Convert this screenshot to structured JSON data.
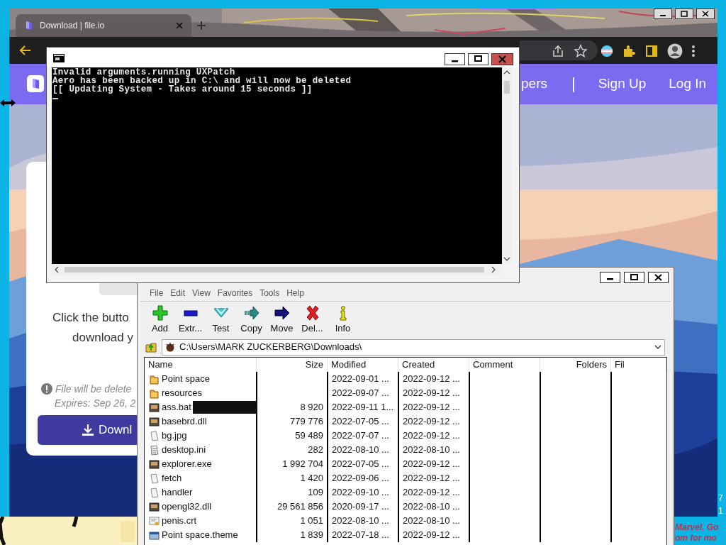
{
  "browser": {
    "tab": {
      "title": "Download | file.io",
      "selected": true
    },
    "nav": {
      "links": [
        "pers",
        "Sign Up",
        "Log In"
      ],
      "separator": "|"
    },
    "card": {
      "lines": [
        "Click the butto",
        "download y"
      ],
      "notice": "File will be delete",
      "expires": "Expires: Sep 26, 2",
      "button": "Downl"
    }
  },
  "console": {
    "lines": [
      "Invalid arguments.running UXPatch",
      "Aero has been backed up in C:\\ and will now be deleted",
      "[[ Updating System - Takes around 15 seconds ]]"
    ]
  },
  "archiver": {
    "menu": [
      "File",
      "Edit",
      "View",
      "Favorites",
      "Tools",
      "Help"
    ],
    "toolbar": [
      {
        "label": "Add",
        "kind": "add"
      },
      {
        "label": "Extr...",
        "kind": "extract"
      },
      {
        "label": "Test",
        "kind": "test"
      },
      {
        "label": "Copy",
        "kind": "copy"
      },
      {
        "label": "Move",
        "kind": "move"
      },
      {
        "label": "Del...",
        "kind": "delete"
      },
      {
        "label": "Info",
        "kind": "info"
      }
    ],
    "path": "C:\\Users\\MARK ZUCKERBERG\\Downloads\\",
    "columns": [
      "Name",
      "Size",
      "Modified",
      "Created",
      "Comment",
      "Folders",
      "Fil"
    ],
    "rows": [
      {
        "name": "Point space",
        "size": "",
        "modified": "2022-09-01 ...",
        "created": "2022-09-12 ...",
        "kind": "folder",
        "redacted": false
      },
      {
        "name": "resources",
        "size": "",
        "modified": "2022-09-07 ...",
        "created": "2022-09-12 ...",
        "kind": "folder",
        "redacted": false
      },
      {
        "name": "ass.bat",
        "size": "8 920",
        "modified": "2022-09-11 1...",
        "created": "2022-09-12 ...",
        "kind": "program",
        "redacted": true
      },
      {
        "name": "basebrd.dll",
        "size": "779 776",
        "modified": "2022-07-05 ...",
        "created": "2022-09-12 ...",
        "kind": "program",
        "redacted": false
      },
      {
        "name": "bg.jpg",
        "size": "59 489",
        "modified": "2022-07-07 ...",
        "created": "2022-09-12 ...",
        "kind": "document",
        "redacted": false
      },
      {
        "name": "desktop.ini",
        "size": "282",
        "modified": "2022-08-10 ...",
        "created": "2022-08-10 ...",
        "kind": "settings",
        "redacted": false
      },
      {
        "name": "explorer.exe",
        "size": "1 992 704",
        "modified": "2022-07-05 ...",
        "created": "2022-09-12 ...",
        "kind": "program",
        "redacted": false
      },
      {
        "name": "fetch",
        "size": "1 420",
        "modified": "2022-09-06 ...",
        "created": "2022-09-12 ...",
        "kind": "document",
        "redacted": false
      },
      {
        "name": "handler",
        "size": "109",
        "modified": "2022-09-10 ...",
        "created": "2022-09-12 ...",
        "kind": "document",
        "redacted": false
      },
      {
        "name": "opengl32.dll",
        "size": "29 561 856",
        "modified": "2020-09-17 ...",
        "created": "2022-08-10 ...",
        "kind": "program",
        "redacted": false
      },
      {
        "name": "penis.crt",
        "size": "1 051",
        "modified": "2022-08-10 ...",
        "created": "2022-08-10 ...",
        "kind": "certificate",
        "redacted": false
      },
      {
        "name": "Point space.theme",
        "size": "1 839",
        "modified": "2022-07-18 ...",
        "created": "2022-09-12 ...",
        "kind": "theme",
        "redacted": false
      }
    ]
  },
  "desktop": {
    "edge_digits": [
      "7",
      "1"
    ],
    "caption": [
      "Marvel. Go",
      "om for mo"
    ]
  }
}
